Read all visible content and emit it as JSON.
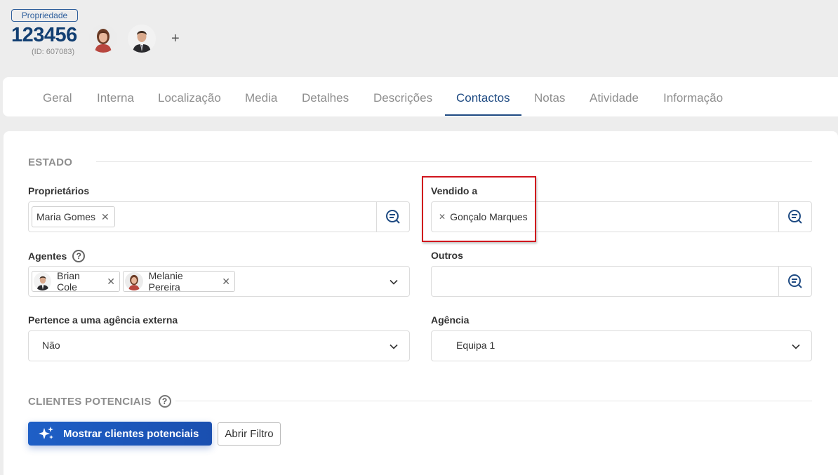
{
  "header": {
    "badge": "Propriedade",
    "property_number": "123456",
    "property_id_label": "(ID: 607083)",
    "add_symbol": "+"
  },
  "tabs": [
    {
      "label": "Geral"
    },
    {
      "label": "Interna"
    },
    {
      "label": "Localização"
    },
    {
      "label": "Media"
    },
    {
      "label": "Detalhes"
    },
    {
      "label": "Descrições"
    },
    {
      "label": "Contactos",
      "active": true
    },
    {
      "label": "Notas"
    },
    {
      "label": "Atividade"
    },
    {
      "label": "Informação"
    }
  ],
  "estado": {
    "title": "ESTADO",
    "proprietarios": {
      "label": "Proprietários",
      "chips": [
        "Maria Gomes"
      ]
    },
    "vendido_a": {
      "label": "Vendido a",
      "chips": [
        "Gonçalo Marques"
      ]
    },
    "agentes": {
      "label": "Agentes",
      "help": "?",
      "chips": [
        "Brian Cole",
        "Melanie Pereira"
      ]
    },
    "outros": {
      "label": "Outros",
      "value": ""
    },
    "agencia_externa": {
      "label": "Pertence a uma agência externa",
      "value": "Não"
    },
    "agencia": {
      "label": "Agência",
      "value": "Equipa 1"
    }
  },
  "clientes": {
    "title": "CLIENTES POTENCIAIS",
    "help": "?",
    "show_button": "Mostrar clientes potenciais",
    "filter_button": "Abrir Filtro"
  },
  "colors": {
    "brand_dark": "#123f72",
    "tab_active": "#1e4a82",
    "primary_button": "#1e5fc6",
    "highlight_box": "#d0141d"
  },
  "icons": {
    "search": "search-list-icon",
    "chevron": "chevron-down-icon",
    "remove": "close-icon",
    "sparkle": "sparkle-icon"
  }
}
